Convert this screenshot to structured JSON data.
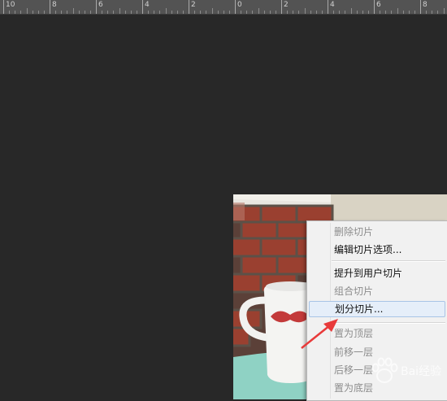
{
  "ruler": {
    "labels": [
      "10",
      "8",
      "6",
      "4",
      "2",
      "0",
      "2",
      "4",
      "6",
      "8"
    ]
  },
  "context_menu": {
    "items": [
      {
        "label": "删除切片",
        "enabled": false
      },
      {
        "label": "编辑切片选项...",
        "enabled": true
      },
      {
        "label": "提升到用户切片",
        "enabled": true
      },
      {
        "label": "组合切片",
        "enabled": false
      },
      {
        "label": "划分切片...",
        "enabled": true,
        "highlighted": true
      },
      {
        "label": "置为顶层",
        "enabled": false
      },
      {
        "label": "前移一层",
        "enabled": false
      },
      {
        "label": "后移一层",
        "enabled": false
      },
      {
        "label": "置为底层",
        "enabled": false
      }
    ]
  },
  "watermark": {
    "text": "Bai经验"
  },
  "colors": {
    "canvas": "#282828",
    "ruler": "#535353",
    "menu_bg": "#f1f1f1",
    "highlight": "#e5eef9",
    "arrow": "#e83a3a"
  }
}
